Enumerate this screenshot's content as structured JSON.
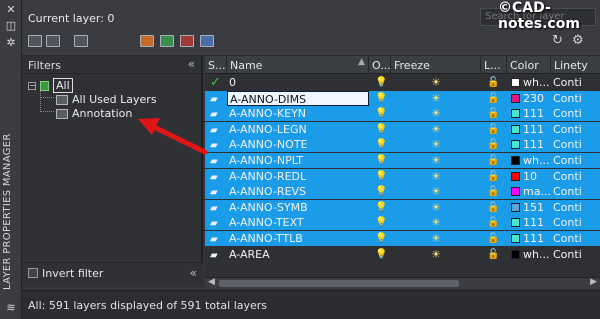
{
  "panel": {
    "vertical_title": "LAYER PROPERTIES MANAGER",
    "current_layer": "Current layer: 0",
    "search_placeholder": "Search for layer",
    "watermark": "©CAD-notes.com"
  },
  "filters": {
    "heading": "Filters",
    "tree": [
      {
        "label": "All",
        "selected": true
      },
      {
        "label": "All Used Layers"
      },
      {
        "label": "Annotation"
      }
    ],
    "invert_label": "Invert filter"
  },
  "columns": [
    "S...",
    "Name",
    "O...",
    "Freeze",
    "L...",
    "Color",
    "Linety"
  ],
  "rows": [
    {
      "name": "0",
      "color_code": "wh...",
      "color": "#ffffff",
      "linetype": "Conti",
      "current": true,
      "selected": false
    },
    {
      "name": "A-ANNO-DIMS",
      "color_code": "230",
      "color": "#e0177c",
      "linetype": "Conti",
      "selected": true,
      "editing": true
    },
    {
      "name": "A-ANNO-KEYN",
      "color_code": "111",
      "color": "#46e6d2",
      "linetype": "Conti",
      "selected": true
    },
    {
      "name": "A-ANNO-LEGN",
      "color_code": "111",
      "color": "#46e6d2",
      "linetype": "Conti",
      "selected": true
    },
    {
      "name": "A-ANNO-NOTE",
      "color_code": "111",
      "color": "#46e6d2",
      "linetype": "Conti",
      "selected": true
    },
    {
      "name": "A-ANNO-NPLT",
      "color_code": "wh...",
      "color": "#000000",
      "linetype": "Conti",
      "selected": true
    },
    {
      "name": "A-ANNO-REDL",
      "color_code": "10",
      "color": "#ff0000",
      "linetype": "Conti",
      "selected": true
    },
    {
      "name": "A-ANNO-REVS",
      "color_code": "ma...",
      "color": "#ff00ff",
      "linetype": "Conti",
      "selected": true
    },
    {
      "name": "A-ANNO-SYMB",
      "color_code": "151",
      "color": "#5aa5e0",
      "linetype": "Conti",
      "selected": true
    },
    {
      "name": "A-ANNO-TEXT",
      "color_code": "111",
      "color": "#46e6d2",
      "linetype": "Conti",
      "selected": true
    },
    {
      "name": "A-ANNO-TTLB",
      "color_code": "111",
      "color": "#46e6d2",
      "linetype": "Conti",
      "selected": true
    },
    {
      "name": "A-AREA",
      "color_code": "wh...",
      "color": "#000000",
      "linetype": "Conti",
      "selected": false
    }
  ],
  "status": "All: 591 layers displayed of 591 total layers",
  "colors": {
    "selection": "#1b9ce8",
    "arrow": "#e01515",
    "panel_bg": "#33353a"
  }
}
